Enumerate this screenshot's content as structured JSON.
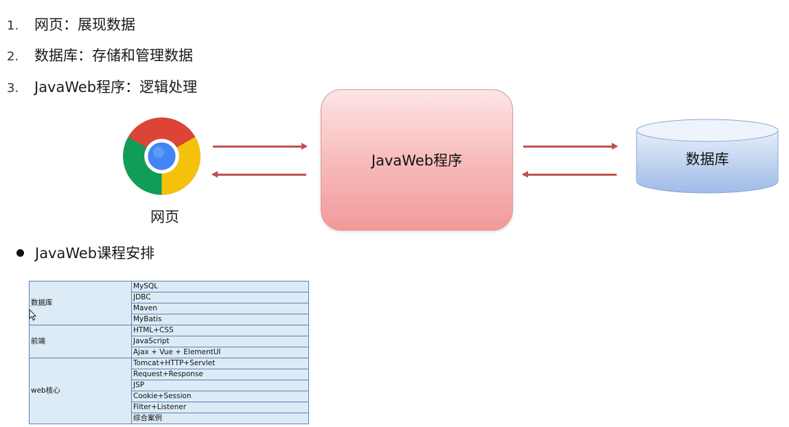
{
  "intro_list": [
    {
      "num": "1.",
      "text": "网页：展现数据"
    },
    {
      "num": "2.",
      "text": "数据库：存储和管理数据"
    },
    {
      "num": "3.",
      "text": "JavaWeb程序：逻辑处理"
    }
  ],
  "diagram": {
    "browser_label": "网页",
    "browser_icon": "chrome-icon",
    "server_label": "JavaWeb程序",
    "database_label": "数据库",
    "arrow_color": "#c0504d"
  },
  "schedule": {
    "heading": "JavaWeb课程安排",
    "groups": [
      {
        "category": "数据库",
        "topics": [
          "MySQL",
          "JDBC",
          "Maven",
          "MyBatis"
        ]
      },
      {
        "category": "前端",
        "topics": [
          "HTML+CSS",
          "JavaScript",
          "Ajax + Vue + ElementUI"
        ]
      },
      {
        "category": "web核心",
        "topics": [
          "Tomcat+HTTP+Servlet",
          "Request+Response",
          "JSP",
          "Cookie+Session",
          "Filter+Listener",
          "综合案例"
        ]
      }
    ]
  }
}
